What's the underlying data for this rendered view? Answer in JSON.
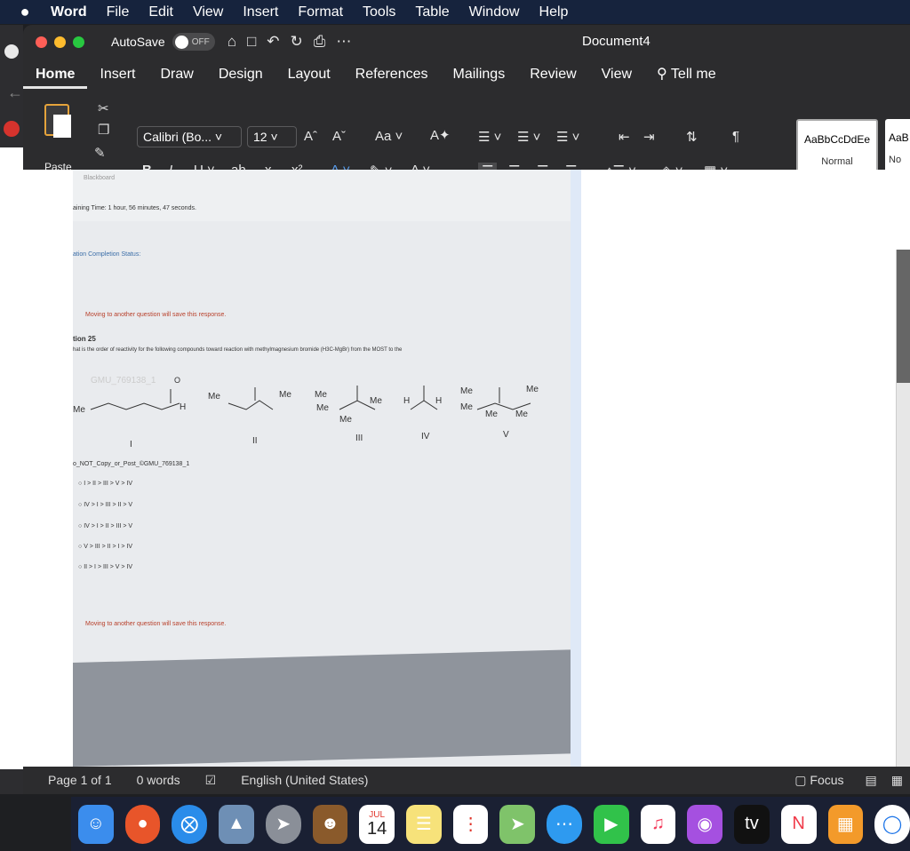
{
  "menubar": {
    "apple": "",
    "app": "Word",
    "items": [
      "File",
      "Edit",
      "View",
      "Insert",
      "Format",
      "Tools",
      "Table",
      "Window",
      "Help"
    ]
  },
  "titlebar": {
    "autosave_label": "AutoSave",
    "autosave_state": "OFF",
    "document_title": "Document4"
  },
  "tabs": [
    "Home",
    "Insert",
    "Draw",
    "Design",
    "Layout",
    "References",
    "Mailings",
    "Review",
    "View"
  ],
  "tell_me": "Tell me",
  "ribbon": {
    "paste_label": "Paste",
    "font_name": "Calibri (Bo...",
    "font_size": "12",
    "case_label": "Aa",
    "styles": [
      {
        "sample": "AaBbCcDdEe",
        "name": "Normal"
      },
      {
        "sample": "AaB",
        "name": "No"
      }
    ]
  },
  "photo": {
    "header": "Blackboard",
    "time_remaining": "aining Time: 1 hour, 56 minutes, 47 seconds.",
    "completion": "ation Completion Status:",
    "warning": "Moving to another question will save this response.",
    "question_num": "tion 25",
    "question": "hat is the order of reactivity for the following compounds toward reaction with methylmagnesium bromide (H3C-MgBr) from the MOST to the",
    "watermark": "GMU_769138_1",
    "compound_labels": [
      "I",
      "II",
      "III",
      "IV",
      "V"
    ],
    "me_labels": [
      "Me",
      "Me",
      "Me",
      "Me",
      "Me",
      "Me",
      "Me",
      "Me",
      "Me",
      "Me",
      "Me",
      "Me"
    ],
    "h_labels": [
      "H",
      "H",
      "H"
    ],
    "copy_notice": "o_NOT_Copy_or_Post_©GMU_769138_1",
    "options": [
      "I > II > III > V > IV",
      "IV > I > III > II > V",
      "IV > I > II > III > V",
      "V > III > II > I > IV",
      "II > I > III > V > IV"
    ],
    "warning2": "Moving to another question will save this response."
  },
  "status": {
    "page": "Page 1 of 1",
    "words": "0 words",
    "language": "English (United States)",
    "focus": "Focus"
  },
  "dock": {
    "calendar_month": "JUL",
    "calendar_day": "14",
    "tv_label": "tv"
  }
}
